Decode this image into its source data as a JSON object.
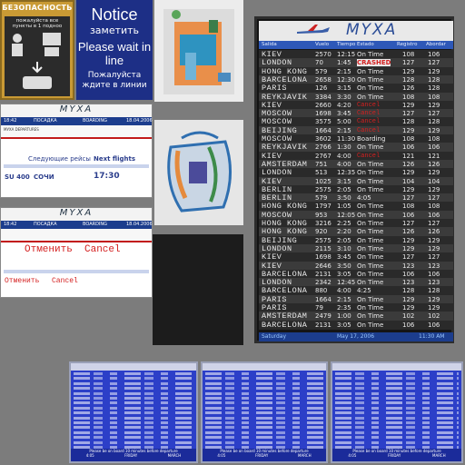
{
  "security_sign": {
    "title": "БЕЗОПАСНОСТЬ",
    "line1": "пожалуйста все",
    "line2": "пункты в 1 подноо"
  },
  "notice_sign": {
    "title_en": "Notice",
    "title_ru": "заметить",
    "msg_en": "Please wait in line",
    "msg_ru": "Пожалуйста ждите в линии"
  },
  "boarding_screen_top": {
    "time": "18:42",
    "heading_ru": "ПОСАДКА",
    "heading_en": "BOARDING",
    "date": "18.04.2006",
    "logo": "MYXA",
    "sub_left": "МУХА DEPARTURES",
    "next_ru": "Следующие рейсы",
    "next_en": "Next flights",
    "flight": "SU 400",
    "dest": "СОЧИ",
    "dep_time": "17:30"
  },
  "boarding_screen_bottom": {
    "time": "18:42",
    "heading_ru": "ПОСАДКА",
    "heading_en": "BOARDING",
    "date": "18.04.2006",
    "logo": "MYXA",
    "cancel_ru": "Отменить",
    "cancel_en": "Cancel"
  },
  "flight_board": {
    "logo": "MYXA",
    "columns": [
      "Salida",
      "Vuelo",
      "Tiempo",
      "Estado",
      "Registro",
      "Abordar"
    ],
    "rows": [
      {
        "city": "KIEV",
        "vuelo": "2570",
        "tiempo": "12:15",
        "estado": "On Time",
        "reg": "108",
        "abo": "106",
        "status": "normal"
      },
      {
        "city": "LONDON",
        "vuelo": "70",
        "tiempo": "1:45",
        "estado": "CRASHED",
        "reg": "127",
        "abo": "127",
        "status": "alert"
      },
      {
        "city": "HONG KONG",
        "vuelo": "579",
        "tiempo": "2:15",
        "estado": "On Time",
        "reg": "129",
        "abo": "129",
        "status": "normal"
      },
      {
        "city": "BARCELONA",
        "vuelo": "2658",
        "tiempo": "12:30",
        "estado": "On Time",
        "reg": "128",
        "abo": "128",
        "status": "normal"
      },
      {
        "city": "PARIS",
        "vuelo": "126",
        "tiempo": "3:15",
        "estado": "On Time",
        "reg": "126",
        "abo": "128",
        "status": "normal"
      },
      {
        "city": "REYKJAVIK",
        "vuelo": "3384",
        "tiempo": "3:30",
        "estado": "On Time",
        "reg": "108",
        "abo": "108",
        "status": "normal"
      },
      {
        "city": "KIEV",
        "vuelo": "2660",
        "tiempo": "4:20",
        "estado": "Cancel",
        "reg": "129",
        "abo": "129",
        "status": "cancel"
      },
      {
        "city": "MOSCOW",
        "vuelo": "1698",
        "tiempo": "3:45",
        "estado": "Cancel",
        "reg": "127",
        "abo": "127",
        "status": "cancel"
      },
      {
        "city": "MOSCOW",
        "vuelo": "3575",
        "tiempo": "5:00",
        "estado": "Cancel",
        "reg": "128",
        "abo": "128",
        "status": "cancel"
      },
      {
        "city": "BEIJING",
        "vuelo": "1664",
        "tiempo": "2:15",
        "estado": "Cancel",
        "reg": "129",
        "abo": "129",
        "status": "cancel"
      },
      {
        "city": "MOSCOW",
        "vuelo": "3602",
        "tiempo": "11:30",
        "estado": "Boarding",
        "reg": "108",
        "abo": "108",
        "status": "normal"
      },
      {
        "city": "REYKJAVIK",
        "vuelo": "2766",
        "tiempo": "1:30",
        "estado": "On Time",
        "reg": "106",
        "abo": "106",
        "status": "normal"
      },
      {
        "city": "KIEV",
        "vuelo": "2767",
        "tiempo": "4:00",
        "estado": "Cancel",
        "reg": "121",
        "abo": "121",
        "status": "cancel"
      },
      {
        "city": "AMSTERDAM",
        "vuelo": "751",
        "tiempo": "4:00",
        "estado": "On Time",
        "reg": "126",
        "abo": "126",
        "status": "normal"
      },
      {
        "city": "LONDON",
        "vuelo": "513",
        "tiempo": "12:35",
        "estado": "On Time",
        "reg": "129",
        "abo": "129",
        "status": "normal"
      },
      {
        "city": "KIEV",
        "vuelo": "1025",
        "tiempo": "3:15",
        "estado": "On Time",
        "reg": "104",
        "abo": "104",
        "status": "normal"
      },
      {
        "city": "BERLIN",
        "vuelo": "2575",
        "tiempo": "2:05",
        "estado": "On Time",
        "reg": "129",
        "abo": "129",
        "status": "normal"
      },
      {
        "city": "BERLIN",
        "vuelo": "579",
        "tiempo": "3:50",
        "estado": "4:05",
        "reg": "127",
        "abo": "127",
        "status": "normal"
      },
      {
        "city": "HONG KONG",
        "vuelo": "1797",
        "tiempo": "1:05",
        "estado": "On Time",
        "reg": "108",
        "abo": "108",
        "status": "normal"
      },
      {
        "city": "MOSCOW",
        "vuelo": "953",
        "tiempo": "12:05",
        "estado": "On Time",
        "reg": "106",
        "abo": "106",
        "status": "normal"
      },
      {
        "city": "HONG KONG",
        "vuelo": "3216",
        "tiempo": "2:25",
        "estado": "On Time",
        "reg": "127",
        "abo": "127",
        "status": "normal"
      },
      {
        "city": "HONG KONG",
        "vuelo": "920",
        "tiempo": "2:20",
        "estado": "On Time",
        "reg": "126",
        "abo": "126",
        "status": "normal"
      },
      {
        "city": "BEIJING",
        "vuelo": "2575",
        "tiempo": "2:05",
        "estado": "On Time",
        "reg": "129",
        "abo": "129",
        "status": "normal"
      },
      {
        "city": "LONDON",
        "vuelo": "2115",
        "tiempo": "3:10",
        "estado": "On Time",
        "reg": "129",
        "abo": "129",
        "status": "normal"
      },
      {
        "city": "KIEV",
        "vuelo": "1698",
        "tiempo": "3:45",
        "estado": "On Time",
        "reg": "127",
        "abo": "127",
        "status": "normal"
      },
      {
        "city": "KIEV",
        "vuelo": "2646",
        "tiempo": "3:50",
        "estado": "On Time",
        "reg": "123",
        "abo": "123",
        "status": "normal"
      },
      {
        "city": "BARCELONA",
        "vuelo": "2131",
        "tiempo": "3:05",
        "estado": "On Time",
        "reg": "106",
        "abo": "106",
        "status": "normal"
      },
      {
        "city": "LONDON",
        "vuelo": "2342",
        "tiempo": "12:45",
        "estado": "On Time",
        "reg": "123",
        "abo": "123",
        "status": "normal"
      },
      {
        "city": "BARCELONA",
        "vuelo": "880",
        "tiempo": "4:00",
        "estado": "4:25",
        "reg": "128",
        "abo": "128",
        "status": "normal"
      },
      {
        "city": "PARIS",
        "vuelo": "1664",
        "tiempo": "2:15",
        "estado": "On Time",
        "reg": "129",
        "abo": "129",
        "status": "normal"
      },
      {
        "city": "PARIS",
        "vuelo": "79",
        "tiempo": "2:35",
        "estado": "On Time",
        "reg": "129",
        "abo": "129",
        "status": "normal"
      },
      {
        "city": "AMSTERDAM",
        "vuelo": "2479",
        "tiempo": "1:00",
        "estado": "On Time",
        "reg": "102",
        "abo": "102",
        "status": "normal"
      },
      {
        "city": "BARCELONA",
        "vuelo": "2131",
        "tiempo": "3:05",
        "estado": "On Time",
        "reg": "106",
        "abo": "106",
        "status": "normal"
      }
    ],
    "footer_day": "Saturday",
    "footer_date": "May 17, 2006",
    "footer_time": "11:30 AM"
  },
  "blue_boards": {
    "footer_note": "Please be on board 10 minutes before departure",
    "day": "FRIDAY",
    "month": "MARCH",
    "time": "4:05"
  },
  "colors": {
    "cancel": "#d42020",
    "alert_bg": "#e9e9e9",
    "row_a": "#2a2a2a",
    "row_b": "#3b3b3b",
    "board_blue": "#2c3fc8"
  }
}
